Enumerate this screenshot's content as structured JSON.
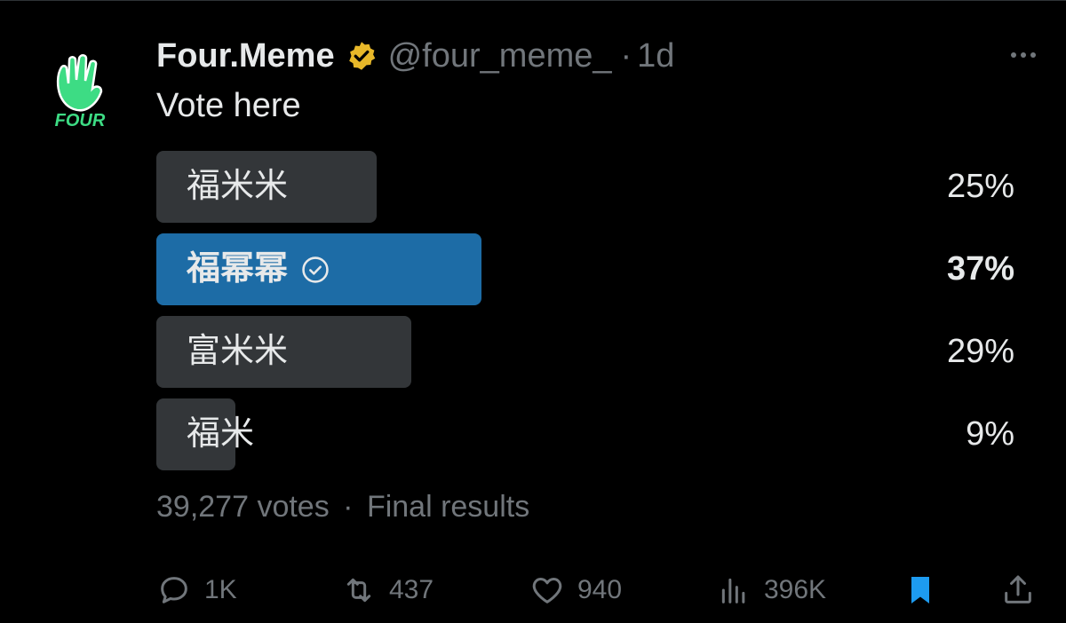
{
  "post": {
    "author_name": "Four.Meme",
    "handle": "@four_meme_",
    "separator": "·",
    "time": "1d",
    "text": "Vote here",
    "avatar_logo_text": "FOUR"
  },
  "poll": {
    "options": [
      {
        "label": "福米米",
        "percent_label": "25%",
        "percent": 25,
        "winner": false
      },
      {
        "label": "福幂幂",
        "percent_label": "37%",
        "percent": 37,
        "winner": true
      },
      {
        "label": "富米米",
        "percent_label": "29%",
        "percent": 29,
        "winner": false
      },
      {
        "label": "福米",
        "percent_label": "9%",
        "percent": 9,
        "winner": false
      }
    ],
    "votes": "39,277 votes",
    "status": "Final results"
  },
  "actions": {
    "replies": "1K",
    "reposts": "437",
    "likes": "940",
    "views": "396K"
  },
  "colors": {
    "background": "#000000",
    "text": "#e7e9ea",
    "secondary": "#71767b",
    "bar": "#333639",
    "winner_bar": "#1d6ca6",
    "bookmark": "#1d9bf0",
    "verified": "#e8b829",
    "logo": "#3ddc84"
  }
}
